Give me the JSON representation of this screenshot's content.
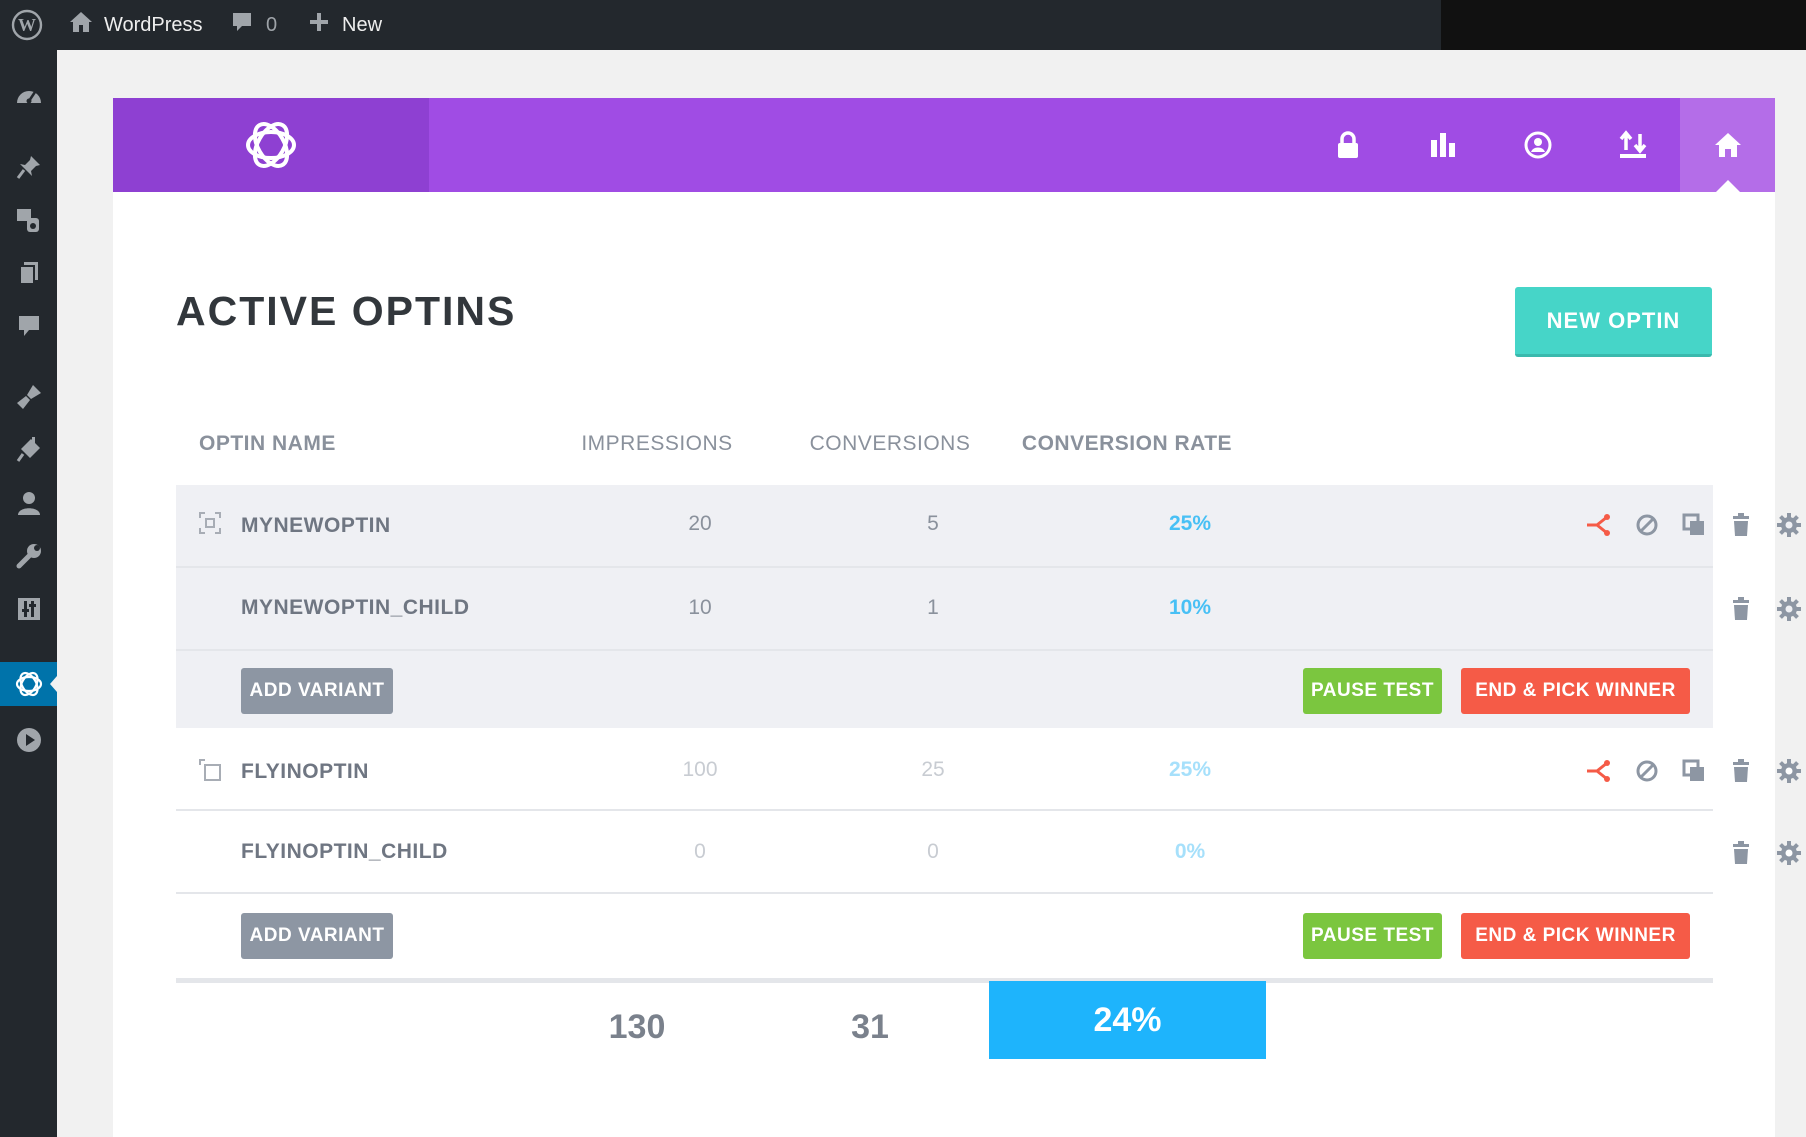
{
  "adminbar": {
    "site_name": "WordPress",
    "comments_count": "0",
    "new_label": "New"
  },
  "page": {
    "title": "ACTIVE OPTINS",
    "new_optin_label": "NEW OPTIN"
  },
  "table": {
    "columns": [
      "OPTIN NAME",
      "IMPRESSIONS",
      "CONVERSIONS",
      "CONVERSION RATE"
    ],
    "groups": [
      {
        "parent": {
          "name": "MYNEWOPTIN",
          "impressions": "20",
          "conversions": "5",
          "rate": "25%"
        },
        "child": {
          "name": "MYNEWOPTIN_CHILD",
          "impressions": "10",
          "conversions": "1",
          "rate": "10%"
        },
        "add_variant_label": "ADD VARIANT",
        "pause_label": "PAUSE TEST",
        "end_label": "END & PICK WINNER"
      },
      {
        "parent": {
          "name": "FLYINOPTIN",
          "impressions": "100",
          "conversions": "25",
          "rate": "25%"
        },
        "child": {
          "name": "FLYINOPTIN_CHILD",
          "impressions": "0",
          "conversions": "0",
          "rate": "0%"
        },
        "add_variant_label": "ADD VARIANT",
        "pause_label": "PAUSE TEST",
        "end_label": "END & PICK WINNER"
      }
    ],
    "totals": {
      "impressions": "130",
      "conversions": "31",
      "rate": "24%"
    }
  },
  "colors": {
    "header": "#a04ce4",
    "accent_teal": "#46d5c8",
    "rate_blue": "#1eb4fc",
    "pause_green": "#7bc63f",
    "end_red": "#f55b47"
  },
  "icons": {
    "header_nav": [
      "lock-icon",
      "chart-icon",
      "account-icon",
      "import-export-icon",
      "home-icon"
    ],
    "row_actions": [
      "split-test-icon",
      "disable-icon",
      "duplicate-icon",
      "delete-icon",
      "settings-icon"
    ]
  }
}
